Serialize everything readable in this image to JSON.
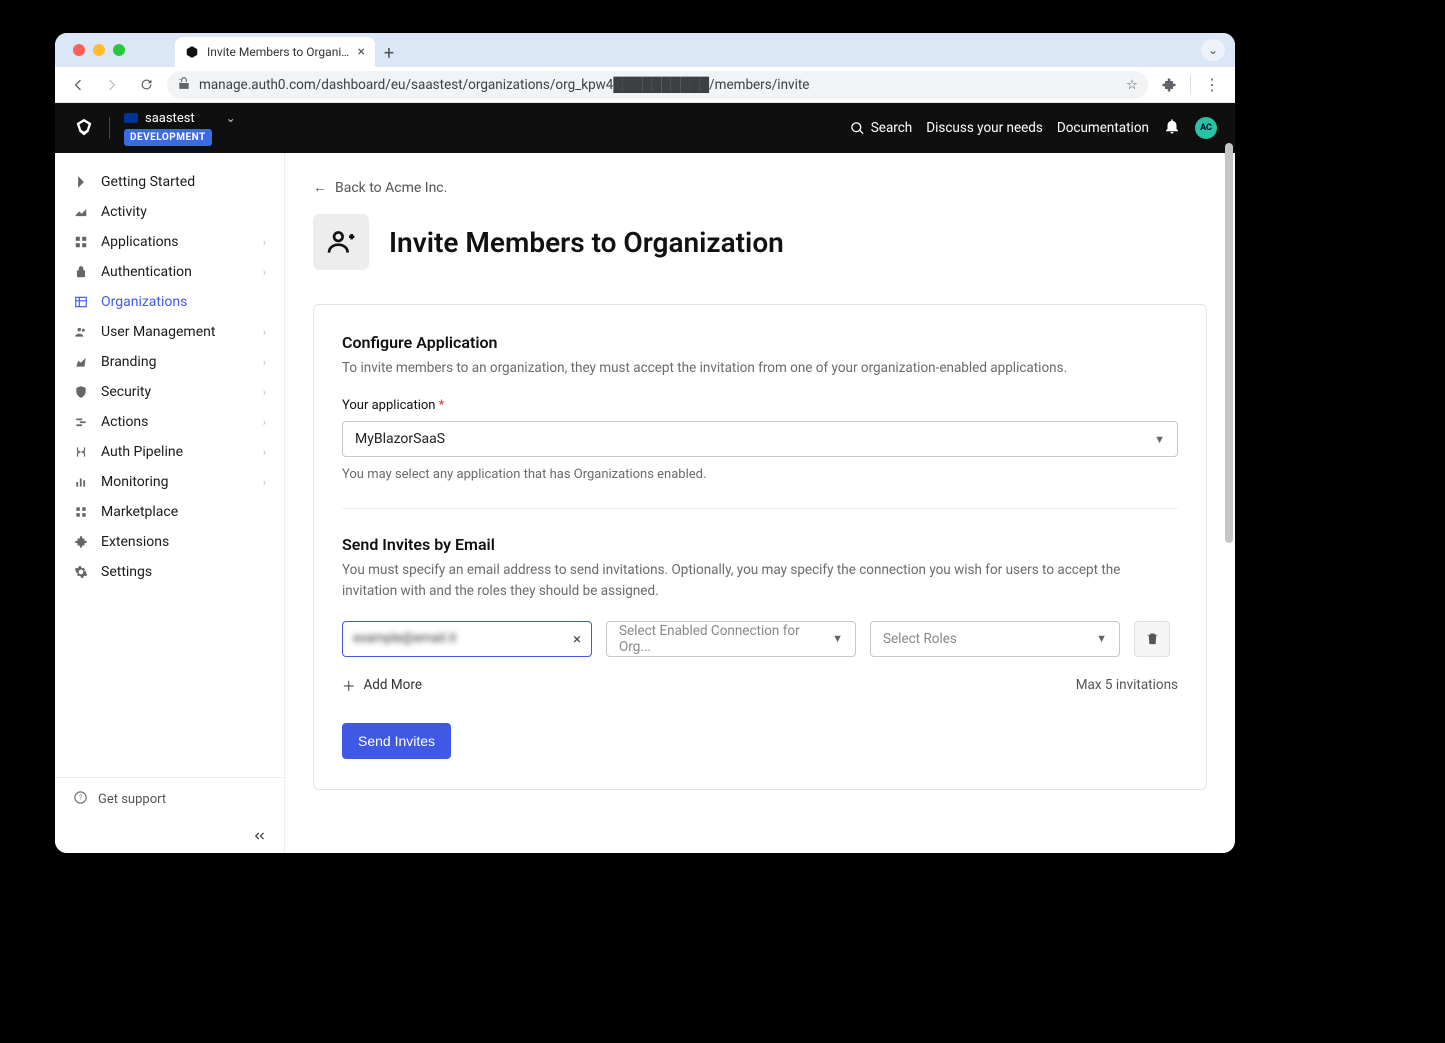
{
  "browser": {
    "tab_title": "Invite Members to Organizati",
    "url": "manage.auth0.com/dashboard/eu/saastest/organizations/org_kpw4██████████/members/invite"
  },
  "header": {
    "tenant_name": "saastest",
    "env_badge": "DEVELOPMENT",
    "search_label": "Search",
    "discuss_label": "Discuss your needs",
    "docs_label": "Documentation",
    "avatar_initials": "AC"
  },
  "sidebar": {
    "items": [
      {
        "label": "Getting Started",
        "expandable": false
      },
      {
        "label": "Activity",
        "expandable": false
      },
      {
        "label": "Applications",
        "expandable": true
      },
      {
        "label": "Authentication",
        "expandable": true
      },
      {
        "label": "Organizations",
        "expandable": false,
        "active": true
      },
      {
        "label": "User Management",
        "expandable": true
      },
      {
        "label": "Branding",
        "expandable": true
      },
      {
        "label": "Security",
        "expandable": true
      },
      {
        "label": "Actions",
        "expandable": true
      },
      {
        "label": "Auth Pipeline",
        "expandable": true
      },
      {
        "label": "Monitoring",
        "expandable": true
      },
      {
        "label": "Marketplace",
        "expandable": false
      },
      {
        "label": "Extensions",
        "expandable": false
      },
      {
        "label": "Settings",
        "expandable": false
      }
    ],
    "support_label": "Get support"
  },
  "main": {
    "back_link": "Back to Acme Inc.",
    "page_title": "Invite Members to Organization",
    "config_section": {
      "title": "Configure Application",
      "desc": "To invite members to an organization, they must accept the invitation from one of your organization-enabled applications.",
      "field_label": "Your application",
      "selected_app": "MyBlazorSaaS",
      "helper": "You may select any application that has Organizations enabled."
    },
    "email_section": {
      "title": "Send Invites by Email",
      "desc": "You must specify an email address to send invitations. Optionally, you may specify the connection you wish for users to accept the invitation with and the roles they should be assigned.",
      "email_value": "example@email.it",
      "connection_placeholder": "Select Enabled Connection for Org...",
      "roles_placeholder": "Select Roles",
      "add_more_label": "Add More",
      "max_label": "Max 5 invitations",
      "send_button": "Send Invites"
    }
  }
}
